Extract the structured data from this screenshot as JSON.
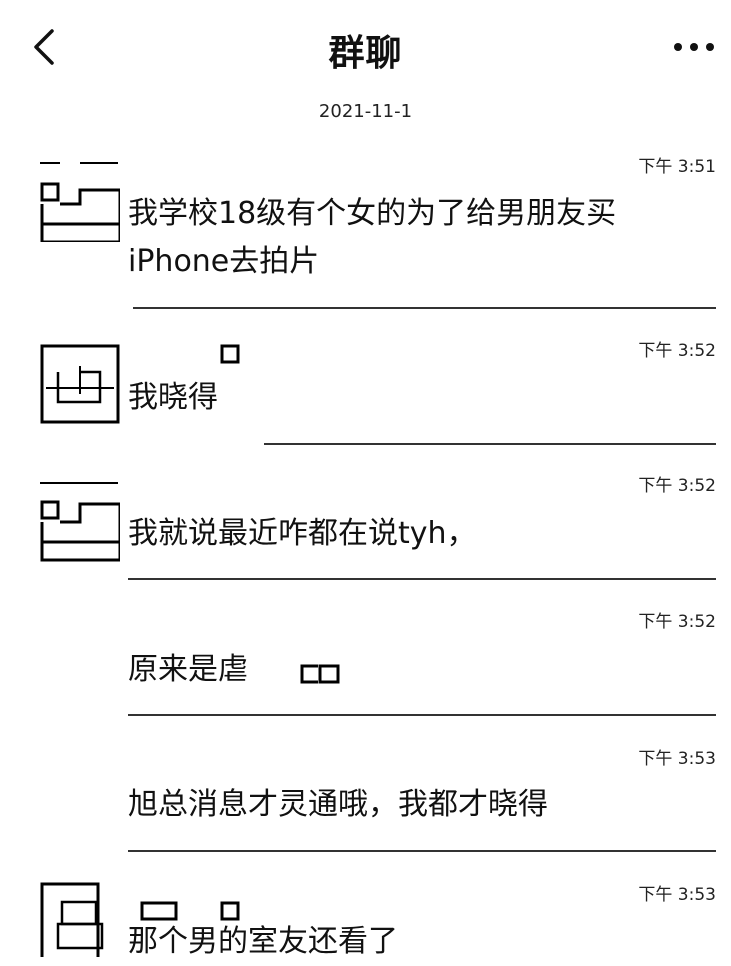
{
  "header": {
    "title": "群聊"
  },
  "date_label": "2021-11-1",
  "messages": [
    {
      "time": "下午 3:51",
      "text": "我学校18级有个女的为了给男朋友买iPhone去拍片"
    },
    {
      "time": "下午 3:52",
      "text": "我晓得"
    },
    {
      "time": "下午 3:52",
      "text": "我就说最近咋都在说tyh，"
    },
    {
      "time": "下午 3:52",
      "text": "原来是虐"
    },
    {
      "time": "下午 3:53",
      "text": "旭总消息才灵通哦，我都才晓得"
    },
    {
      "time": "下午 3:53",
      "text": "那个男的室友还看了"
    }
  ],
  "icons": {
    "back": "chevron-left-icon",
    "more": "more-dots-icon"
  },
  "colors": {
    "text": "#111111",
    "divider": "#333333",
    "background": "#ffffff"
  }
}
